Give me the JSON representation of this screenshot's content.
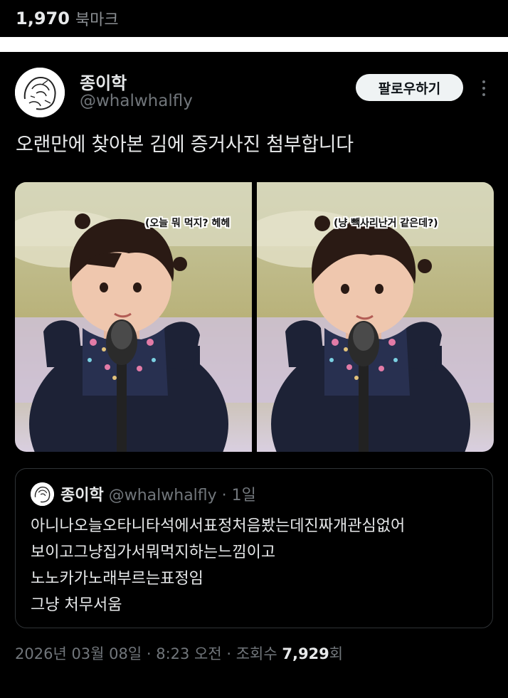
{
  "top": {
    "bookmark_count": "1,970",
    "bookmark_label": "북마크"
  },
  "post": {
    "author_name": "종이학",
    "author_handle": "@whalwhalfly",
    "follow_label": "팔로우하기",
    "text": "오랜만에 찾아본 김에 증거사진 첨부합니다",
    "media": [
      {
        "caption": "(오늘 뭐 먹지? 헤헤"
      },
      {
        "caption": "(냥 빽사리난거 같은데?)"
      }
    ],
    "quote": {
      "name": "종이학",
      "handle_time": "@whalwhalfly · 1일",
      "lines": [
        "아니나오늘오타니타석에서표정처음봤는데진짜개관심없어",
        "보이고그냥집가서뭐먹지하는느낌이고",
        "노노카가노래부르는표정임",
        "그냥 처무서움"
      ]
    },
    "meta_prefix": "2026년 03월 08일 · 8:23 오전 · 조회수 ",
    "views": "7,929",
    "views_suffix": "회"
  },
  "colors": {
    "background": "#000000",
    "text": "#e7e9ea",
    "muted": "#71767b",
    "border": "#2f3336"
  },
  "icons": [
    "avatar-sketch-icon",
    "more-dots-icon"
  ]
}
